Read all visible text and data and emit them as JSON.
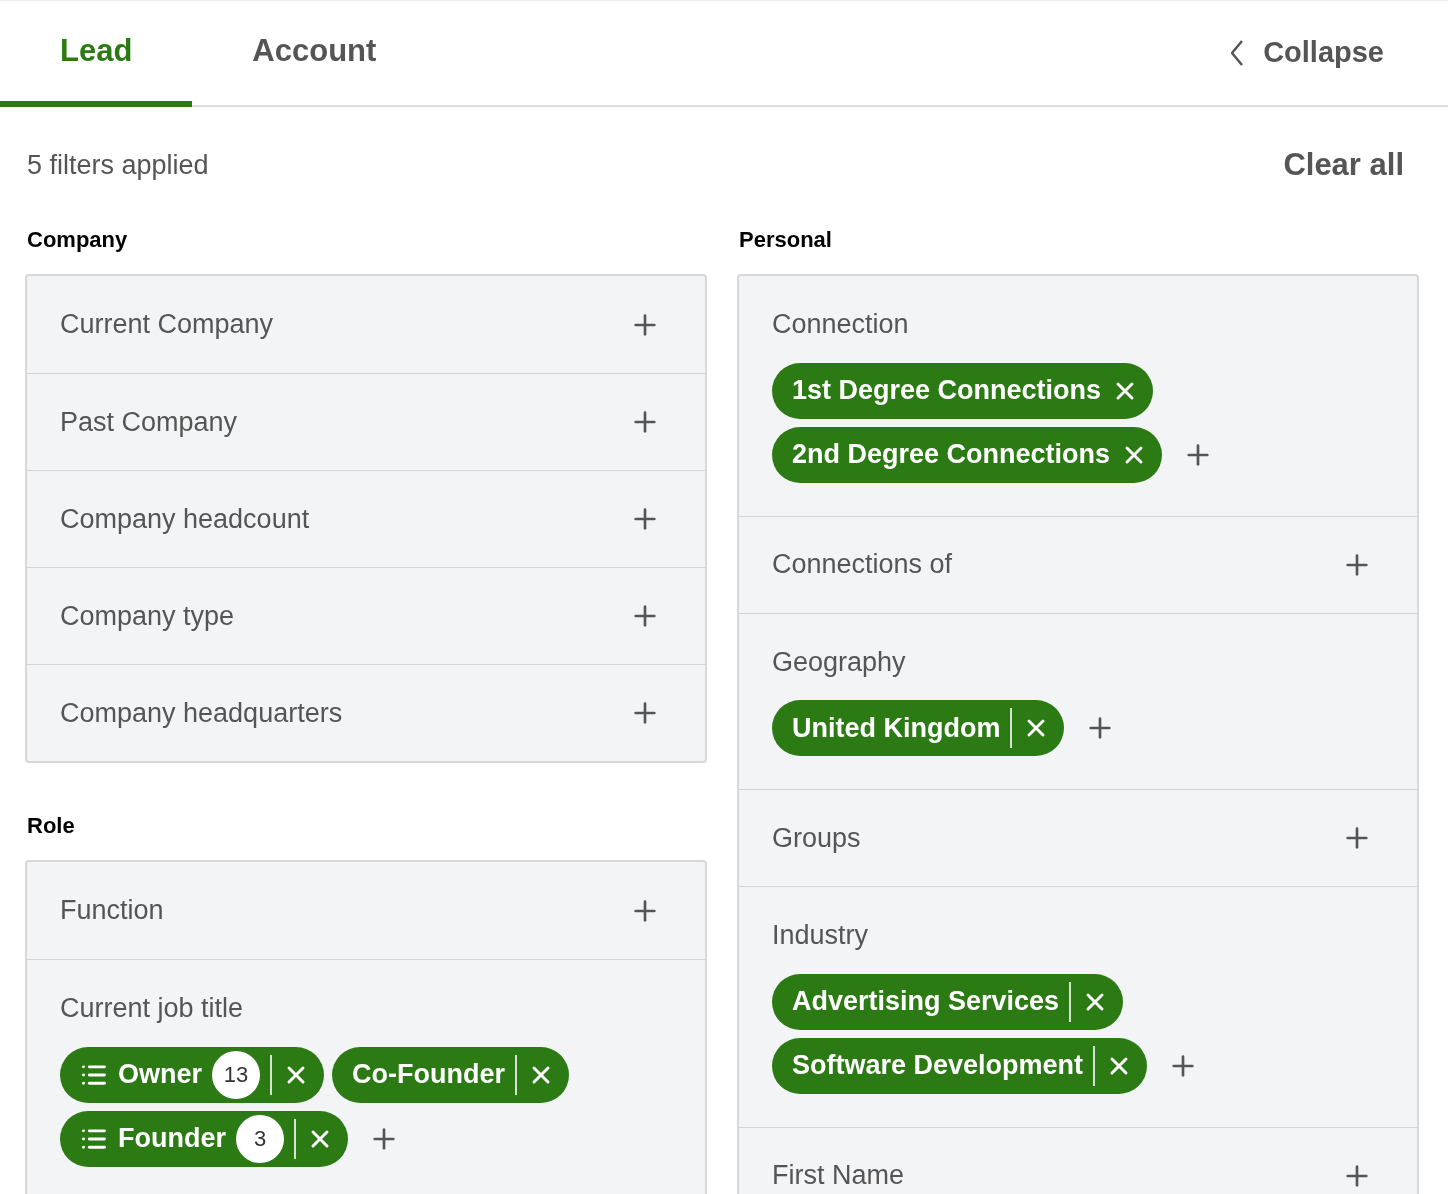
{
  "tabs": [
    {
      "label": "Lead",
      "selected": true
    },
    {
      "label": "Account",
      "selected": false
    }
  ],
  "collapse": {
    "label": "Collapse"
  },
  "summary": {
    "text": "5 filters applied",
    "clear": "Clear all"
  },
  "columns": [
    {
      "sections": [
        {
          "title": "Company",
          "rows": [
            {
              "label": "Current Company"
            },
            {
              "label": "Past Company"
            },
            {
              "label": "Company headcount"
            },
            {
              "label": "Company type"
            },
            {
              "label": "Company headquarters"
            }
          ]
        },
        {
          "title": "Role",
          "rows": [
            {
              "label": "Function"
            },
            {
              "label": "Current job title",
              "pills": [
                {
                  "kind": "list",
                  "label": "Owner",
                  "count": "13"
                },
                {
                  "kind": "split",
                  "label": "Co-Founder"
                },
                {
                  "kind": "list",
                  "label": "Founder",
                  "count": "3"
                }
              ]
            }
          ]
        }
      ]
    },
    {
      "sections": [
        {
          "title": "Personal",
          "rows": [
            {
              "label": "Connection",
              "pills": [
                {
                  "kind": "plain",
                  "label": "1st Degree Connections"
                },
                {
                  "kind": "plain",
                  "label": "2nd Degree Connections"
                }
              ]
            },
            {
              "label": "Connections of"
            },
            {
              "label": "Geography",
              "pills": [
                {
                  "kind": "split",
                  "label": "United Kingdom"
                }
              ]
            },
            {
              "label": "Groups"
            },
            {
              "label": "Industry",
              "pills": [
                {
                  "kind": "split",
                  "label": "Advertising Services"
                },
                {
                  "kind": "split",
                  "label": "Software Development"
                }
              ]
            },
            {
              "label": "First Name"
            }
          ]
        }
      ]
    }
  ]
}
